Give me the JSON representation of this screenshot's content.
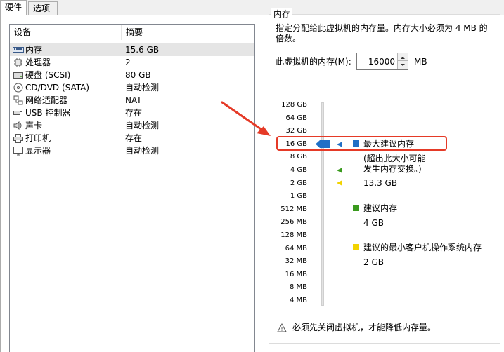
{
  "tabs": [
    {
      "label": "硬件",
      "active": true
    },
    {
      "label": "选项",
      "active": false
    }
  ],
  "device_list": {
    "headers": {
      "device": "设备",
      "summary": "摘要"
    },
    "rows": [
      {
        "icon": "memory-icon",
        "name": "内存",
        "summary": "15.6 GB",
        "selected": true
      },
      {
        "icon": "cpu-icon",
        "name": "处理器",
        "summary": "2",
        "selected": false
      },
      {
        "icon": "disk-icon",
        "name": "硬盘 (SCSI)",
        "summary": "80 GB",
        "selected": false
      },
      {
        "icon": "cd-icon",
        "name": "CD/DVD (SATA)",
        "summary": "自动检测",
        "selected": false
      },
      {
        "icon": "network-icon",
        "name": "网络适配器",
        "summary": "NAT",
        "selected": false
      },
      {
        "icon": "usb-icon",
        "name": "USB 控制器",
        "summary": "存在",
        "selected": false
      },
      {
        "icon": "sound-icon",
        "name": "声卡",
        "summary": "自动检测",
        "selected": false
      },
      {
        "icon": "printer-icon",
        "name": "打印机",
        "summary": "存在",
        "selected": false
      },
      {
        "icon": "monitor-icon",
        "name": "显示器",
        "summary": "自动检测",
        "selected": false
      }
    ]
  },
  "memory": {
    "group_title": "内存",
    "description": "指定分配给此虚拟机的内存量。内存大小必须为 4 MB 的倍数。",
    "field_label": "此虚拟机的内存(M):",
    "value": "16000",
    "unit": "MB",
    "scale_ticks": [
      "128 GB",
      "64 GB",
      "32 GB",
      "16 GB",
      "8 GB",
      "4 GB",
      "2 GB",
      "1 GB",
      "512 MB",
      "256 MB",
      "128 MB",
      "64 MB",
      "32 MB",
      "16 MB",
      "8 MB",
      "4 MB"
    ],
    "legend": {
      "max": {
        "title": "最大建议内存",
        "note": "(超出此大小可能\n发生内存交换。)",
        "value": "13.3 GB",
        "color": "#1f6fc6"
      },
      "recommended": {
        "title": "建议内存",
        "value": "4 GB",
        "color": "#3a9a1e"
      },
      "min_guest": {
        "title": "建议的最小客户机操作系统内存",
        "value": "2 GB",
        "color": "#f2d300"
      }
    },
    "warning": "必须先关闭虚拟机，才能降低内存量。"
  },
  "colors": {
    "annotation": "#e53a27"
  }
}
